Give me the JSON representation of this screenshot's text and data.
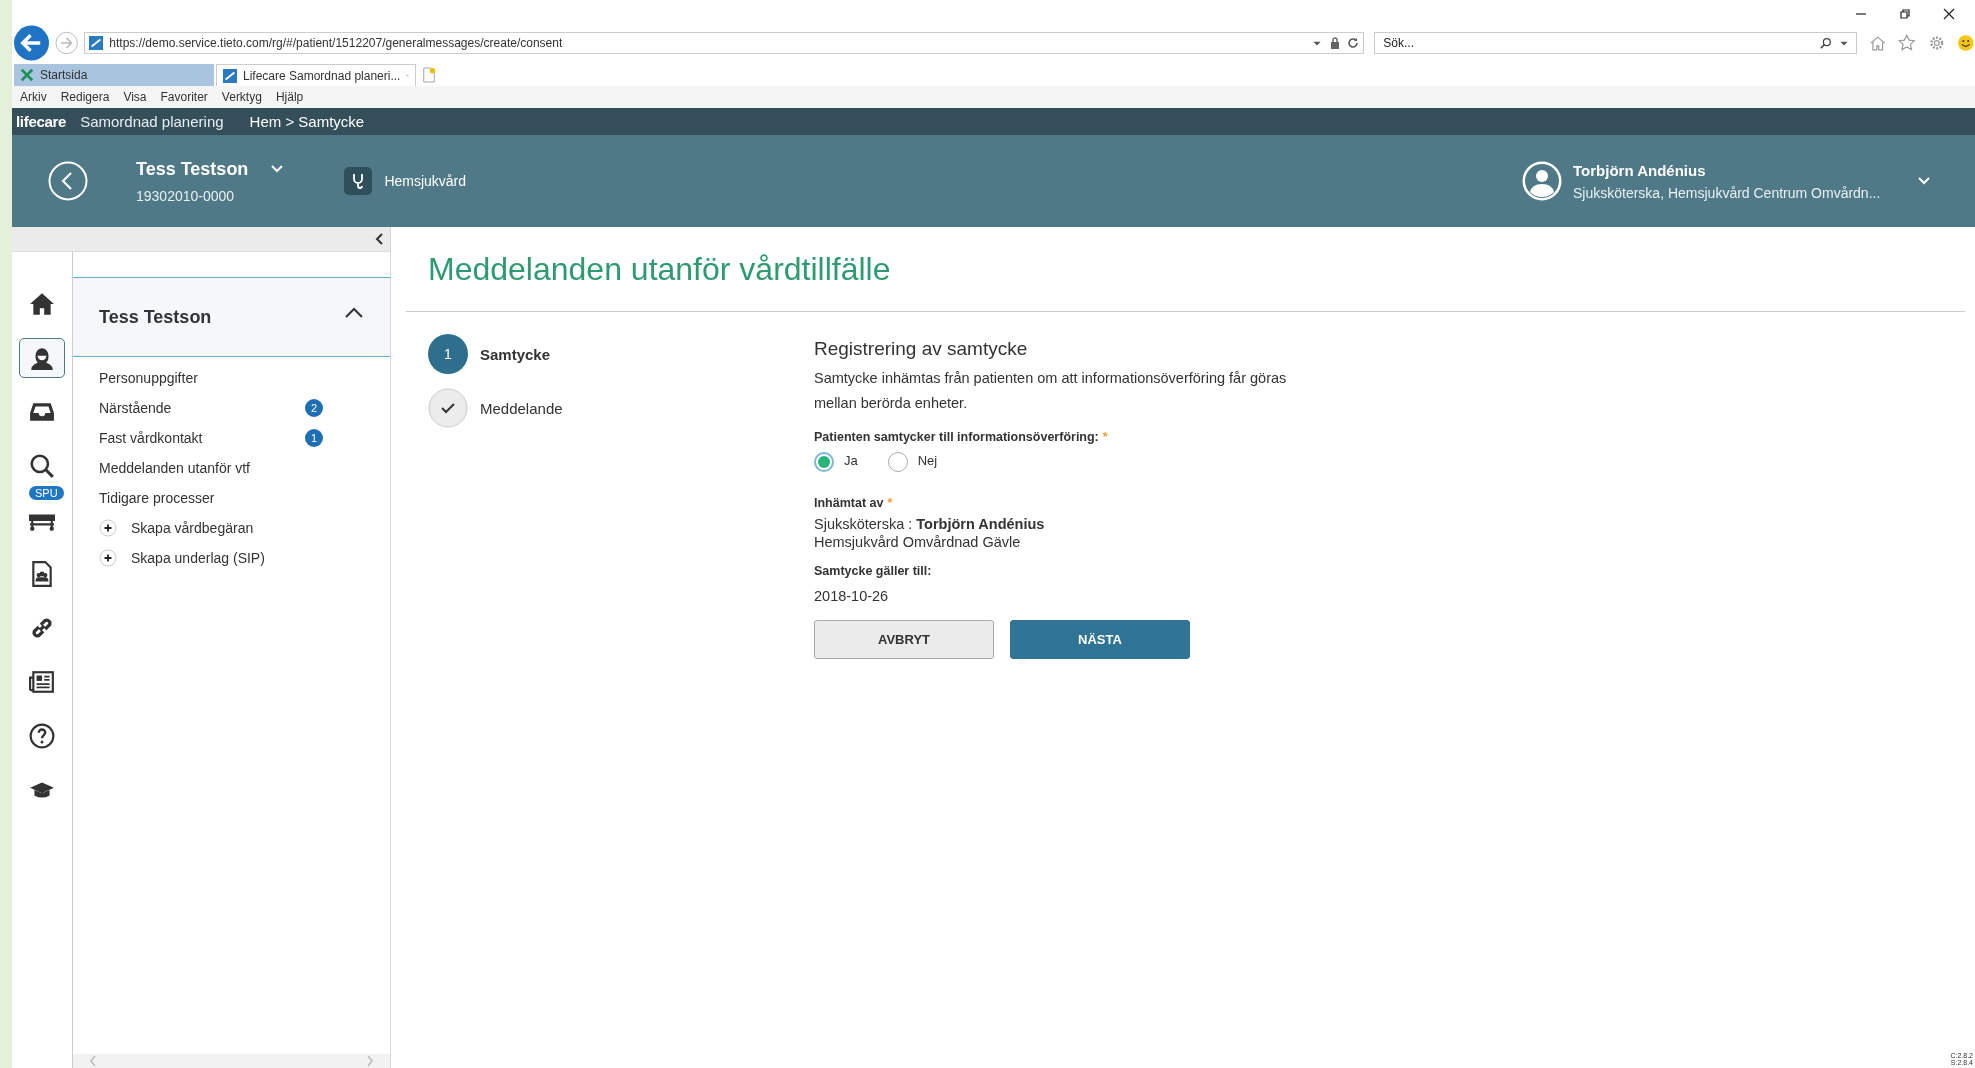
{
  "browser": {
    "url": "https://demo.service.tieto.com/rg/#/patient/1512207/generalmessages/create/consent",
    "search_placeholder": "Sök...",
    "tabs": [
      {
        "label": "Startsida",
        "selected": false
      },
      {
        "label": "Lifecare Samordnad planeri...",
        "selected": true
      }
    ],
    "menu": [
      "Arkiv",
      "Redigera",
      "Visa",
      "Favoriter",
      "Verktyg",
      "Hjälp"
    ]
  },
  "app_bar": {
    "logo": "lifecare",
    "product": "Samordnad planering",
    "breadcrumb": "Hem > Samtycke"
  },
  "patient_header": {
    "name": "Tess Testson",
    "id": "19302010-0000",
    "unit": "Hemsjukvård",
    "user": {
      "name": "Torbjörn Andénius",
      "role": "Sjuksköterska, Hemsjukvård Centrum Omvårdn..."
    }
  },
  "rail": [
    {
      "kind": "home",
      "selected": false
    },
    {
      "kind": "person",
      "selected": true
    },
    {
      "kind": "inbox",
      "selected": false
    },
    {
      "kind": "search",
      "selected": false
    },
    {
      "kind": "bed",
      "selected": false,
      "badge": "SPU"
    },
    {
      "kind": "document",
      "selected": false
    },
    {
      "kind": "link",
      "selected": false
    },
    {
      "kind": "news",
      "selected": false
    },
    {
      "kind": "help",
      "selected": false
    },
    {
      "kind": "education",
      "selected": false
    }
  ],
  "panel": {
    "title": "Tess Testson",
    "expanded": true,
    "items": [
      {
        "kind": "link",
        "label": "Personuppgifter"
      },
      {
        "kind": "link",
        "label": "Närstående",
        "badge": "2"
      },
      {
        "kind": "link",
        "label": "Fast vårdkontakt",
        "badge": "1"
      },
      {
        "kind": "link",
        "label": "Meddelanden utanför vtf"
      },
      {
        "kind": "link",
        "label": "Tidigare processer"
      },
      {
        "kind": "add",
        "label": "Skapa vårdbegäran"
      },
      {
        "kind": "add",
        "label": "Skapa underlag (SIP)"
      }
    ]
  },
  "page": {
    "title": "Meddelanden utanför vårdtillfälle",
    "steps": [
      {
        "kind": "current",
        "number": "1",
        "label": "Samtycke"
      },
      {
        "kind": "done",
        "label": "Meddelande"
      }
    ],
    "form": {
      "heading": "Registrering av samtycke",
      "description": "Samtycke inhämtas från patienten om att informationsöverföring får göras mellan berörda enheter.",
      "consent_label": "Patienten samtycker till informationsöverföring:",
      "consent_required": "*",
      "options": [
        {
          "label": "Ja",
          "selected": true
        },
        {
          "label": "Nej",
          "selected": false
        }
      ],
      "collected_label": "Inhämtat av",
      "collected_required": "*",
      "collected_by": "Sjuksköterska : **Torbjörn Andénius**",
      "collected_unit": "Hemsjukvård Omvårdnad Gävle",
      "valid_label": "Samtycke gäller till:",
      "valid_value": "2018-10-26",
      "buttons": [
        {
          "kind": "secondary",
          "label": "AVBRYT"
        },
        {
          "kind": "primary",
          "label": "NÄSTA"
        }
      ]
    }
  },
  "version": [
    "C:2.8.2",
    "S:2.8.4"
  ]
}
